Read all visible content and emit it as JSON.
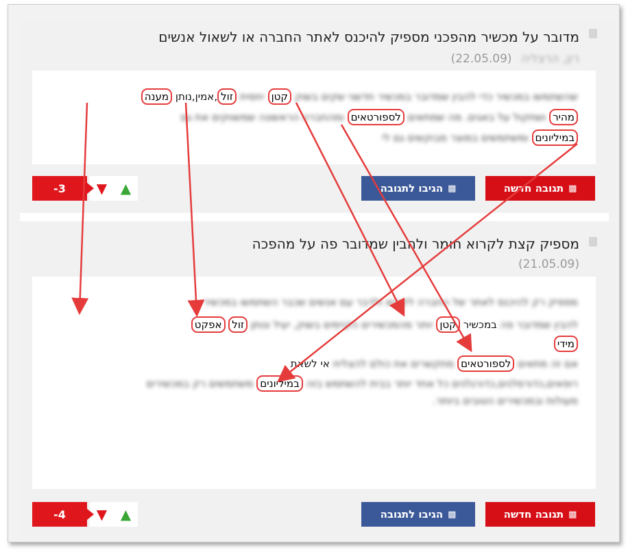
{
  "posts": [
    {
      "title": "מדובר על מכשיר מהפכני מספיק להיכנס לאתר החברה או לשאול אנשים",
      "author": "רון, הרצליה",
      "date": "(22.05.09)",
      "lines": [
        {
          "blur1": "שהשתמשו במכשיר כדי להבין שמדובר במכשיר חדשני שקים בשוק",
          "hl1": "קטן",
          "blur2": "יחסית",
          "hl2": "זול",
          "t1": ",אמין,נותן",
          "hl3": "מענה"
        },
        {
          "hl1": "מהיר",
          "blur1": "ושתקול על באגים. מה שמתאים",
          "hl2": "לספורטאים",
          "blur2": "ומהחברה הראשונה שמשווקים את גם"
        },
        {
          "hl1": "במיליונים",
          "blur1": "ומשתמשים במוצר מבוקשים גם לי"
        }
      ],
      "new_reply": "תגובה חדשה",
      "reply": "הגיבו לתגובה",
      "score": "-3"
    },
    {
      "title": "מספיק קצת לקרוא חומר ולהבין שמדובר פה על מהפכה",
      "author": "",
      "date": "(21.05.09)",
      "lines": [
        {
          "blur1": "מספיק רק להיכנס לאתר של החברה לקרוא ולדבר עם אנשים שכבר השתמשו במכשיר",
          "t1": "-"
        },
        {
          "blur1": "להבין שמדובר פה",
          "t1": "במכשיר",
          "hl1": "קטן",
          "blur2": "יותר מהמכשירים הקיימים בשוק, יעיל ונותן",
          "hl2": "זול",
          "hl3": "אפקט"
        },
        {
          "hl1": "מידי"
        },
        {
          "blur1": "אם זה מתאים",
          "hl1": "לספורטאים",
          "blur2": "מתקשרים את כולם להצליח",
          "t1": "אי לשאת"
        },
        {
          "blur1": "רופאים,כדורסלנים,כדורגלנים כל אחד יותר בבית להשתמש בזה",
          "hl1": "במיליונים",
          "blur2": "משתמשים רק במכשירים"
        },
        {
          "blur1": "מעולות ובמכשירים הטובים ביותר."
        }
      ],
      "new_reply": "תגובה חדשה",
      "reply": "הגיבו לתגובה",
      "score": "-4"
    }
  ],
  "icons": {
    "comment": "comment-icon",
    "thumb_up": "thumb-up-icon",
    "thumb_down": "thumb-down-icon"
  },
  "colors": {
    "red": "#d60f17",
    "blue": "#3b5998",
    "green": "#3aa635",
    "annotation": "#e53b3b"
  }
}
